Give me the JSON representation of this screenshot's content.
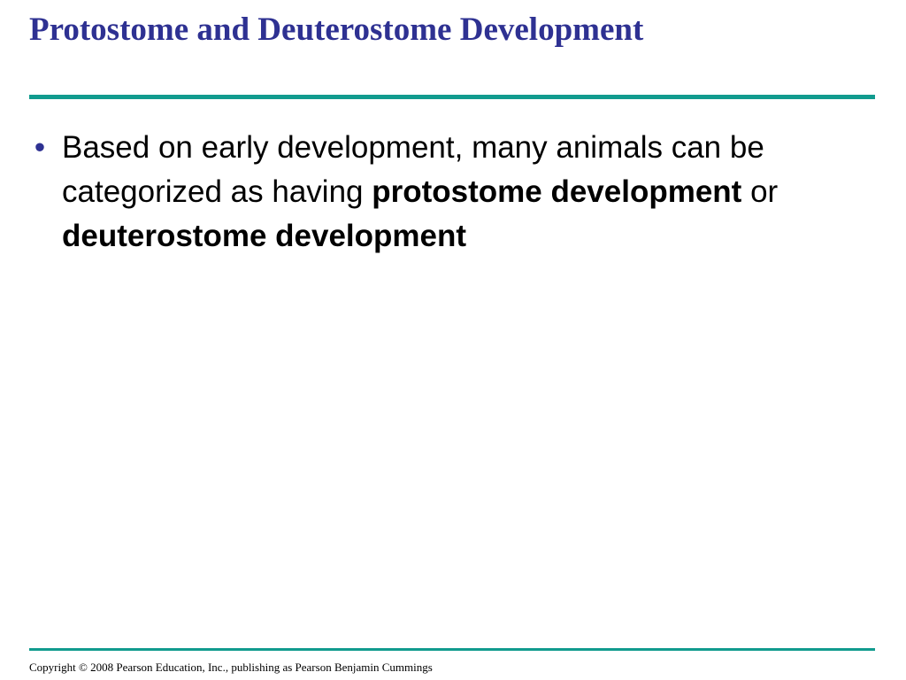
{
  "slide": {
    "title": "Protostome and Deuterostome Development",
    "bullets": [
      {
        "bullet_char": "•",
        "segments": [
          {
            "text": "Based on early development, many animals can be categorized as having ",
            "bold": false
          },
          {
            "text": "protostome development",
            "bold": true
          },
          {
            "text": " or ",
            "bold": false
          },
          {
            "text": "deuterostome development",
            "bold": true
          }
        ]
      }
    ],
    "footer": "Copyright © 2008 Pearson Education, Inc., publishing as Pearson Benjamin Cummings"
  },
  "colors": {
    "title": "#2e3192",
    "rule": "#119b8e",
    "body_text": "#000000",
    "background": "#ffffff"
  }
}
